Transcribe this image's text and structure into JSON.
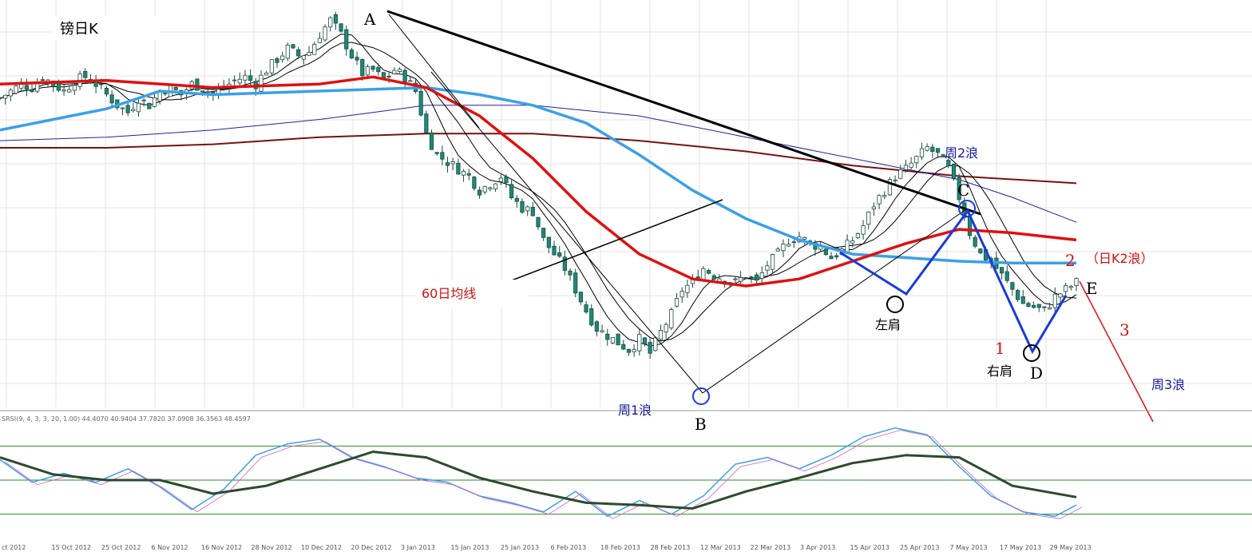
{
  "title": "镑日K",
  "indicator_text": "SRSI(9, 4, 3, 3, 20, 1.00) 44.4070 40.9404 37.7820 37.0908 36.3563 48.4597",
  "colors": {
    "bg": "#ffffff",
    "grid": "#e3e3e3",
    "bull": "#ffffff",
    "bear": "#1a8a7a",
    "ma_red": "#e01010",
    "ma_blue": "#3aa0e8",
    "ma_navy": "#2020a0",
    "ma_dark": "#7a1010",
    "trend": "#000000",
    "pattern": "#1a3adc",
    "wave3": "#e01010",
    "osc_dark": "#2d4a2d",
    "osc_light": "#3aa0e8"
  },
  "annotations": {
    "point_A": "A",
    "point_B": "B",
    "point_C": "C",
    "point_D": "D",
    "point_E": "E",
    "ma60": "60日均线",
    "left_shoulder": "左肩",
    "right_shoulder": "右肩",
    "week_wave_1": "周1浪",
    "week_wave_2": "周2浪",
    "week_wave_3": "周3浪",
    "num_1": "1",
    "num_2": "2",
    "num_3": "3",
    "daily_wave_2": "（日K2浪）"
  },
  "chart_data": {
    "type": "candlestick",
    "title": "镑日K",
    "x_ticks": [
      "ct 2012",
      "15 Oct 2012",
      "25 Oct 2012",
      "6 Nov 2012",
      "16 Nov 2012",
      "28 Nov 2012",
      "10 Dec 2012",
      "20 Dec 2012",
      "3 Jan 2013",
      "15 Jan 2013",
      "25 Jan 2013",
      "6 Feb 2013",
      "18 Feb 2013",
      "28 Feb 2013",
      "12 Mar 2013",
      "22 Mar 2013",
      "3 Apr 2013",
      "15 Apr 2013",
      "25 Apr 2013",
      "7 May 2013",
      "17 May 2013",
      "29 May 2013"
    ],
    "close_path": [
      [
        0,
        0.72
      ],
      [
        2,
        0.74
      ],
      [
        4,
        0.76
      ],
      [
        6,
        0.75
      ],
      [
        8,
        0.78
      ],
      [
        10,
        0.76
      ],
      [
        12,
        0.74
      ],
      [
        14,
        0.77
      ],
      [
        16,
        0.78
      ],
      [
        18,
        0.76
      ],
      [
        20,
        0.73
      ],
      [
        22,
        0.7
      ],
      [
        24,
        0.68
      ],
      [
        26,
        0.72
      ],
      [
        28,
        0.7
      ],
      [
        30,
        0.74
      ],
      [
        32,
        0.75
      ],
      [
        34,
        0.73
      ],
      [
        36,
        0.76
      ],
      [
        38,
        0.75
      ],
      [
        40,
        0.73
      ],
      [
        42,
        0.75
      ],
      [
        44,
        0.77
      ],
      [
        46,
        0.78
      ],
      [
        48,
        0.76
      ],
      [
        50,
        0.8
      ],
      [
        52,
        0.83
      ],
      [
        54,
        0.86
      ],
      [
        56,
        0.84
      ],
      [
        58,
        0.85
      ],
      [
        60,
        0.9
      ],
      [
        62,
        0.94
      ],
      [
        64,
        0.9
      ],
      [
        66,
        0.84
      ],
      [
        68,
        0.79
      ],
      [
        70,
        0.8
      ],
      [
        72,
        0.77
      ],
      [
        74,
        0.8
      ],
      [
        76,
        0.78
      ],
      [
        78,
        0.74
      ],
      [
        80,
        0.62
      ],
      [
        82,
        0.56
      ],
      [
        84,
        0.54
      ],
      [
        86,
        0.52
      ],
      [
        88,
        0.5
      ],
      [
        90,
        0.46
      ],
      [
        92,
        0.48
      ],
      [
        94,
        0.5
      ],
      [
        96,
        0.44
      ],
      [
        98,
        0.41
      ],
      [
        100,
        0.4
      ],
      [
        102,
        0.32
      ],
      [
        104,
        0.28
      ],
      [
        106,
        0.24
      ],
      [
        108,
        0.18
      ],
      [
        110,
        0.12
      ],
      [
        112,
        0.07
      ],
      [
        114,
        0.05
      ],
      [
        116,
        0.03
      ],
      [
        118,
        0.01
      ],
      [
        120,
        0.04
      ],
      [
        122,
        0.0
      ],
      [
        124,
        0.06
      ],
      [
        126,
        0.11
      ],
      [
        128,
        0.18
      ],
      [
        130,
        0.2
      ],
      [
        132,
        0.24
      ],
      [
        134,
        0.22
      ],
      [
        136,
        0.21
      ],
      [
        138,
        0.2
      ],
      [
        140,
        0.22
      ],
      [
        142,
        0.2
      ],
      [
        144,
        0.25
      ],
      [
        146,
        0.28
      ],
      [
        148,
        0.32
      ],
      [
        150,
        0.33
      ],
      [
        152,
        0.31
      ],
      [
        154,
        0.3
      ],
      [
        156,
        0.27
      ],
      [
        158,
        0.29
      ],
      [
        160,
        0.32
      ],
      [
        162,
        0.36
      ],
      [
        164,
        0.42
      ],
      [
        166,
        0.46
      ],
      [
        168,
        0.5
      ],
      [
        170,
        0.52
      ],
      [
        172,
        0.55
      ],
      [
        174,
        0.58
      ],
      [
        176,
        0.56
      ],
      [
        178,
        0.52
      ],
      [
        180,
        0.44
      ],
      [
        182,
        0.34
      ],
      [
        184,
        0.28
      ],
      [
        186,
        0.26
      ],
      [
        188,
        0.22
      ],
      [
        190,
        0.18
      ],
      [
        192,
        0.14
      ],
      [
        194,
        0.13
      ],
      [
        196,
        0.12
      ],
      [
        198,
        0.16
      ],
      [
        200,
        0.18
      ],
      [
        202,
        0.2
      ]
    ],
    "x_range": [
      0,
      202
    ],
    "y_range": [
      -0.13,
      0.97
    ],
    "moving_averages": [
      {
        "name": "60日均线",
        "color": "#e01010",
        "path": [
          [
            0,
            0.76
          ],
          [
            20,
            0.77
          ],
          [
            40,
            0.75
          ],
          [
            60,
            0.76
          ],
          [
            70,
            0.78
          ],
          [
            80,
            0.75
          ],
          [
            90,
            0.67
          ],
          [
            100,
            0.55
          ],
          [
            110,
            0.4
          ],
          [
            120,
            0.28
          ],
          [
            130,
            0.21
          ],
          [
            140,
            0.19
          ],
          [
            150,
            0.21
          ],
          [
            160,
            0.26
          ],
          [
            170,
            0.31
          ],
          [
            180,
            0.35
          ],
          [
            190,
            0.34
          ],
          [
            202,
            0.32
          ]
        ]
      },
      {
        "name": "",
        "color": "#3aa0e8",
        "path": [
          [
            0,
            0.63
          ],
          [
            20,
            0.69
          ],
          [
            30,
            0.74
          ],
          [
            40,
            0.73
          ],
          [
            60,
            0.74
          ],
          [
            80,
            0.75
          ],
          [
            90,
            0.73
          ],
          [
            100,
            0.7
          ],
          [
            110,
            0.65
          ],
          [
            120,
            0.56
          ],
          [
            130,
            0.46
          ],
          [
            140,
            0.38
          ],
          [
            150,
            0.32
          ],
          [
            160,
            0.28
          ],
          [
            170,
            0.27
          ],
          [
            180,
            0.26
          ],
          [
            190,
            0.255
          ],
          [
            202,
            0.255
          ]
        ]
      },
      {
        "name": "",
        "color": "#2020a0",
        "path": [
          [
            0,
            0.6
          ],
          [
            20,
            0.61
          ],
          [
            40,
            0.63
          ],
          [
            60,
            0.66
          ],
          [
            70,
            0.68
          ],
          [
            80,
            0.7
          ],
          [
            100,
            0.7
          ],
          [
            120,
            0.67
          ],
          [
            140,
            0.61
          ],
          [
            160,
            0.55
          ],
          [
            180,
            0.49
          ],
          [
            190,
            0.44
          ],
          [
            202,
            0.37
          ]
        ]
      },
      {
        "name": "",
        "color": "#7a1010",
        "path": [
          [
            0,
            0.58
          ],
          [
            20,
            0.58
          ],
          [
            40,
            0.59
          ],
          [
            60,
            0.61
          ],
          [
            80,
            0.62
          ],
          [
            100,
            0.62
          ],
          [
            120,
            0.6
          ],
          [
            140,
            0.57
          ],
          [
            160,
            0.53
          ],
          [
            180,
            0.5
          ],
          [
            202,
            0.48
          ]
        ]
      }
    ],
    "indicator": {
      "name": "SRSI",
      "params": "9, 4, 3, 3, 20, 1.00",
      "values": [
        44.407,
        40.9404,
        37.782,
        37.0908,
        36.3563,
        48.4597
      ],
      "y_range": [
        0,
        100
      ],
      "levels": [
        20,
        50,
        80
      ],
      "slow_path": [
        [
          0,
          70
        ],
        [
          10,
          55
        ],
        [
          20,
          50
        ],
        [
          30,
          50
        ],
        [
          40,
          38
        ],
        [
          50,
          45
        ],
        [
          60,
          60
        ],
        [
          70,
          75
        ],
        [
          80,
          70
        ],
        [
          90,
          52
        ],
        [
          100,
          40
        ],
        [
          110,
          30
        ],
        [
          120,
          28
        ],
        [
          130,
          25
        ],
        [
          140,
          40
        ],
        [
          150,
          52
        ],
        [
          160,
          65
        ],
        [
          170,
          72
        ],
        [
          180,
          70
        ],
        [
          190,
          45
        ],
        [
          202,
          35
        ]
      ],
      "fast_path": [
        [
          0,
          68
        ],
        [
          6,
          48
        ],
        [
          12,
          56
        ],
        [
          18,
          48
        ],
        [
          24,
          60
        ],
        [
          30,
          44
        ],
        [
          36,
          24
        ],
        [
          42,
          42
        ],
        [
          48,
          72
        ],
        [
          54,
          82
        ],
        [
          60,
          86
        ],
        [
          66,
          70
        ],
        [
          72,
          62
        ],
        [
          78,
          52
        ],
        [
          84,
          48
        ],
        [
          90,
          36
        ],
        [
          96,
          30
        ],
        [
          102,
          22
        ],
        [
          108,
          40
        ],
        [
          114,
          18
        ],
        [
          120,
          32
        ],
        [
          126,
          20
        ],
        [
          132,
          36
        ],
        [
          138,
          64
        ],
        [
          144,
          70
        ],
        [
          150,
          60
        ],
        [
          156,
          72
        ],
        [
          162,
          88
        ],
        [
          168,
          96
        ],
        [
          174,
          90
        ],
        [
          180,
          62
        ],
        [
          186,
          36
        ],
        [
          192,
          22
        ],
        [
          198,
          18
        ],
        [
          202,
          28
        ]
      ]
    }
  }
}
